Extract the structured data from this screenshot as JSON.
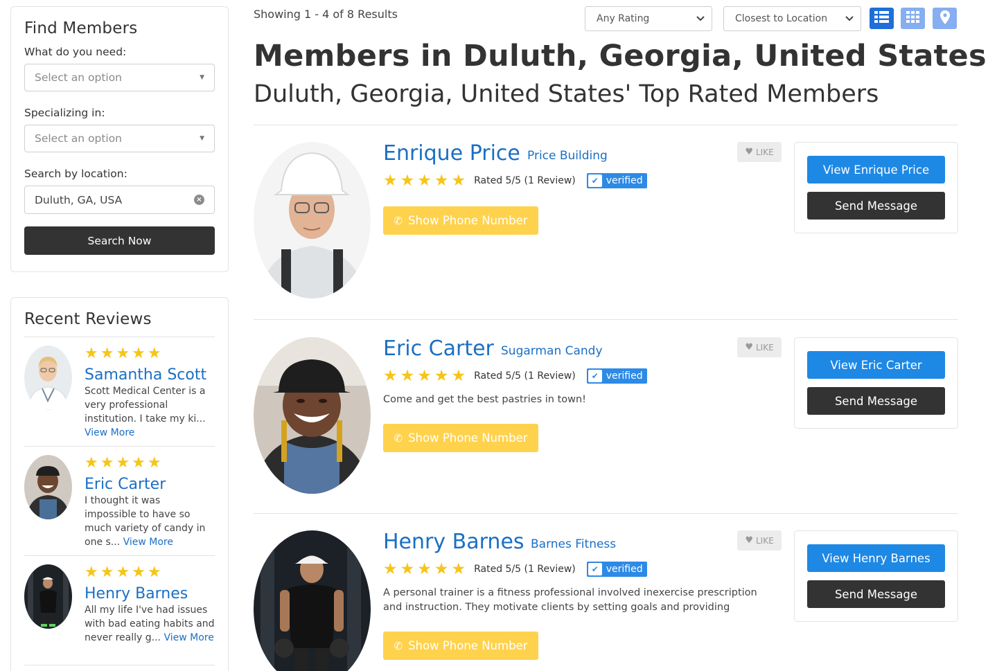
{
  "sidebar": {
    "find": {
      "title": "Find Members",
      "need_label": "What do you need:",
      "need_placeholder": "Select an option",
      "special_label": "Specializing in:",
      "special_placeholder": "Select an option",
      "location_label": "Search by location:",
      "location_value": "Duluth, GA, USA",
      "search_button": "Search Now"
    },
    "reviews": {
      "title": "Recent Reviews",
      "items": [
        {
          "name": "Samantha Scott",
          "stars": "★★★★★",
          "text": "Scott Medical Center is a very professional institution. I take my ki...",
          "more": "View More"
        },
        {
          "name": "Eric Carter",
          "stars": "★★★★★",
          "text": "I thought it was impossible to have so much variety of candy in one s...",
          "more": "View More"
        },
        {
          "name": "Henry Barnes",
          "stars": "★★★★★",
          "text": "All my life I've had issues with bad eating habits and never really g...",
          "more": "View More"
        }
      ]
    }
  },
  "toolbar": {
    "results": "Showing 1 - 4 of 8 Results",
    "rating_select": "Any Rating",
    "sort_select": "Closest to Location",
    "view_icons": [
      "list-view-icon",
      "grid-view-icon",
      "map-view-icon"
    ]
  },
  "heading": {
    "title": "Members in Duluth, Georgia, United States",
    "subtitle": "Duluth, Georgia, United States' Top Rated Members"
  },
  "members": [
    {
      "name": "Enrique Price",
      "company": "Price Building",
      "stars": "★★★★★",
      "rated": "Rated 5/5 (1 Review)",
      "verified": "verified",
      "description": "",
      "phone_button": "Show Phone Number",
      "like": "LIKE",
      "view_button": "View Enrique Price",
      "message_button": "Send Message"
    },
    {
      "name": "Eric Carter",
      "company": "Sugarman Candy",
      "stars": "★★★★★",
      "rated": "Rated 5/5 (1 Review)",
      "verified": "verified",
      "description": "Come and get the best pastries in town!",
      "phone_button": "Show Phone Number",
      "like": "LIKE",
      "view_button": "View Eric Carter",
      "message_button": "Send Message"
    },
    {
      "name": "Henry Barnes",
      "company": "Barnes Fitness",
      "stars": "★★★★★",
      "rated": "Rated 5/5 (1 Review)",
      "verified": "verified",
      "description": "A personal trainer is a fitness professional involved inexercise prescription and instruction. They motivate clients by setting goals and providing",
      "phone_button": "Show Phone Number",
      "like": "LIKE",
      "view_button": "View Henry Barnes",
      "message_button": "Send Message"
    }
  ],
  "colors": {
    "link_blue": "#1a6fc4",
    "button_blue": "#1e88e5",
    "verified_blue": "#2d8ae6",
    "star_yellow": "#f5c518",
    "phone_yellow": "#ffd24d",
    "dark_button": "#333333"
  }
}
